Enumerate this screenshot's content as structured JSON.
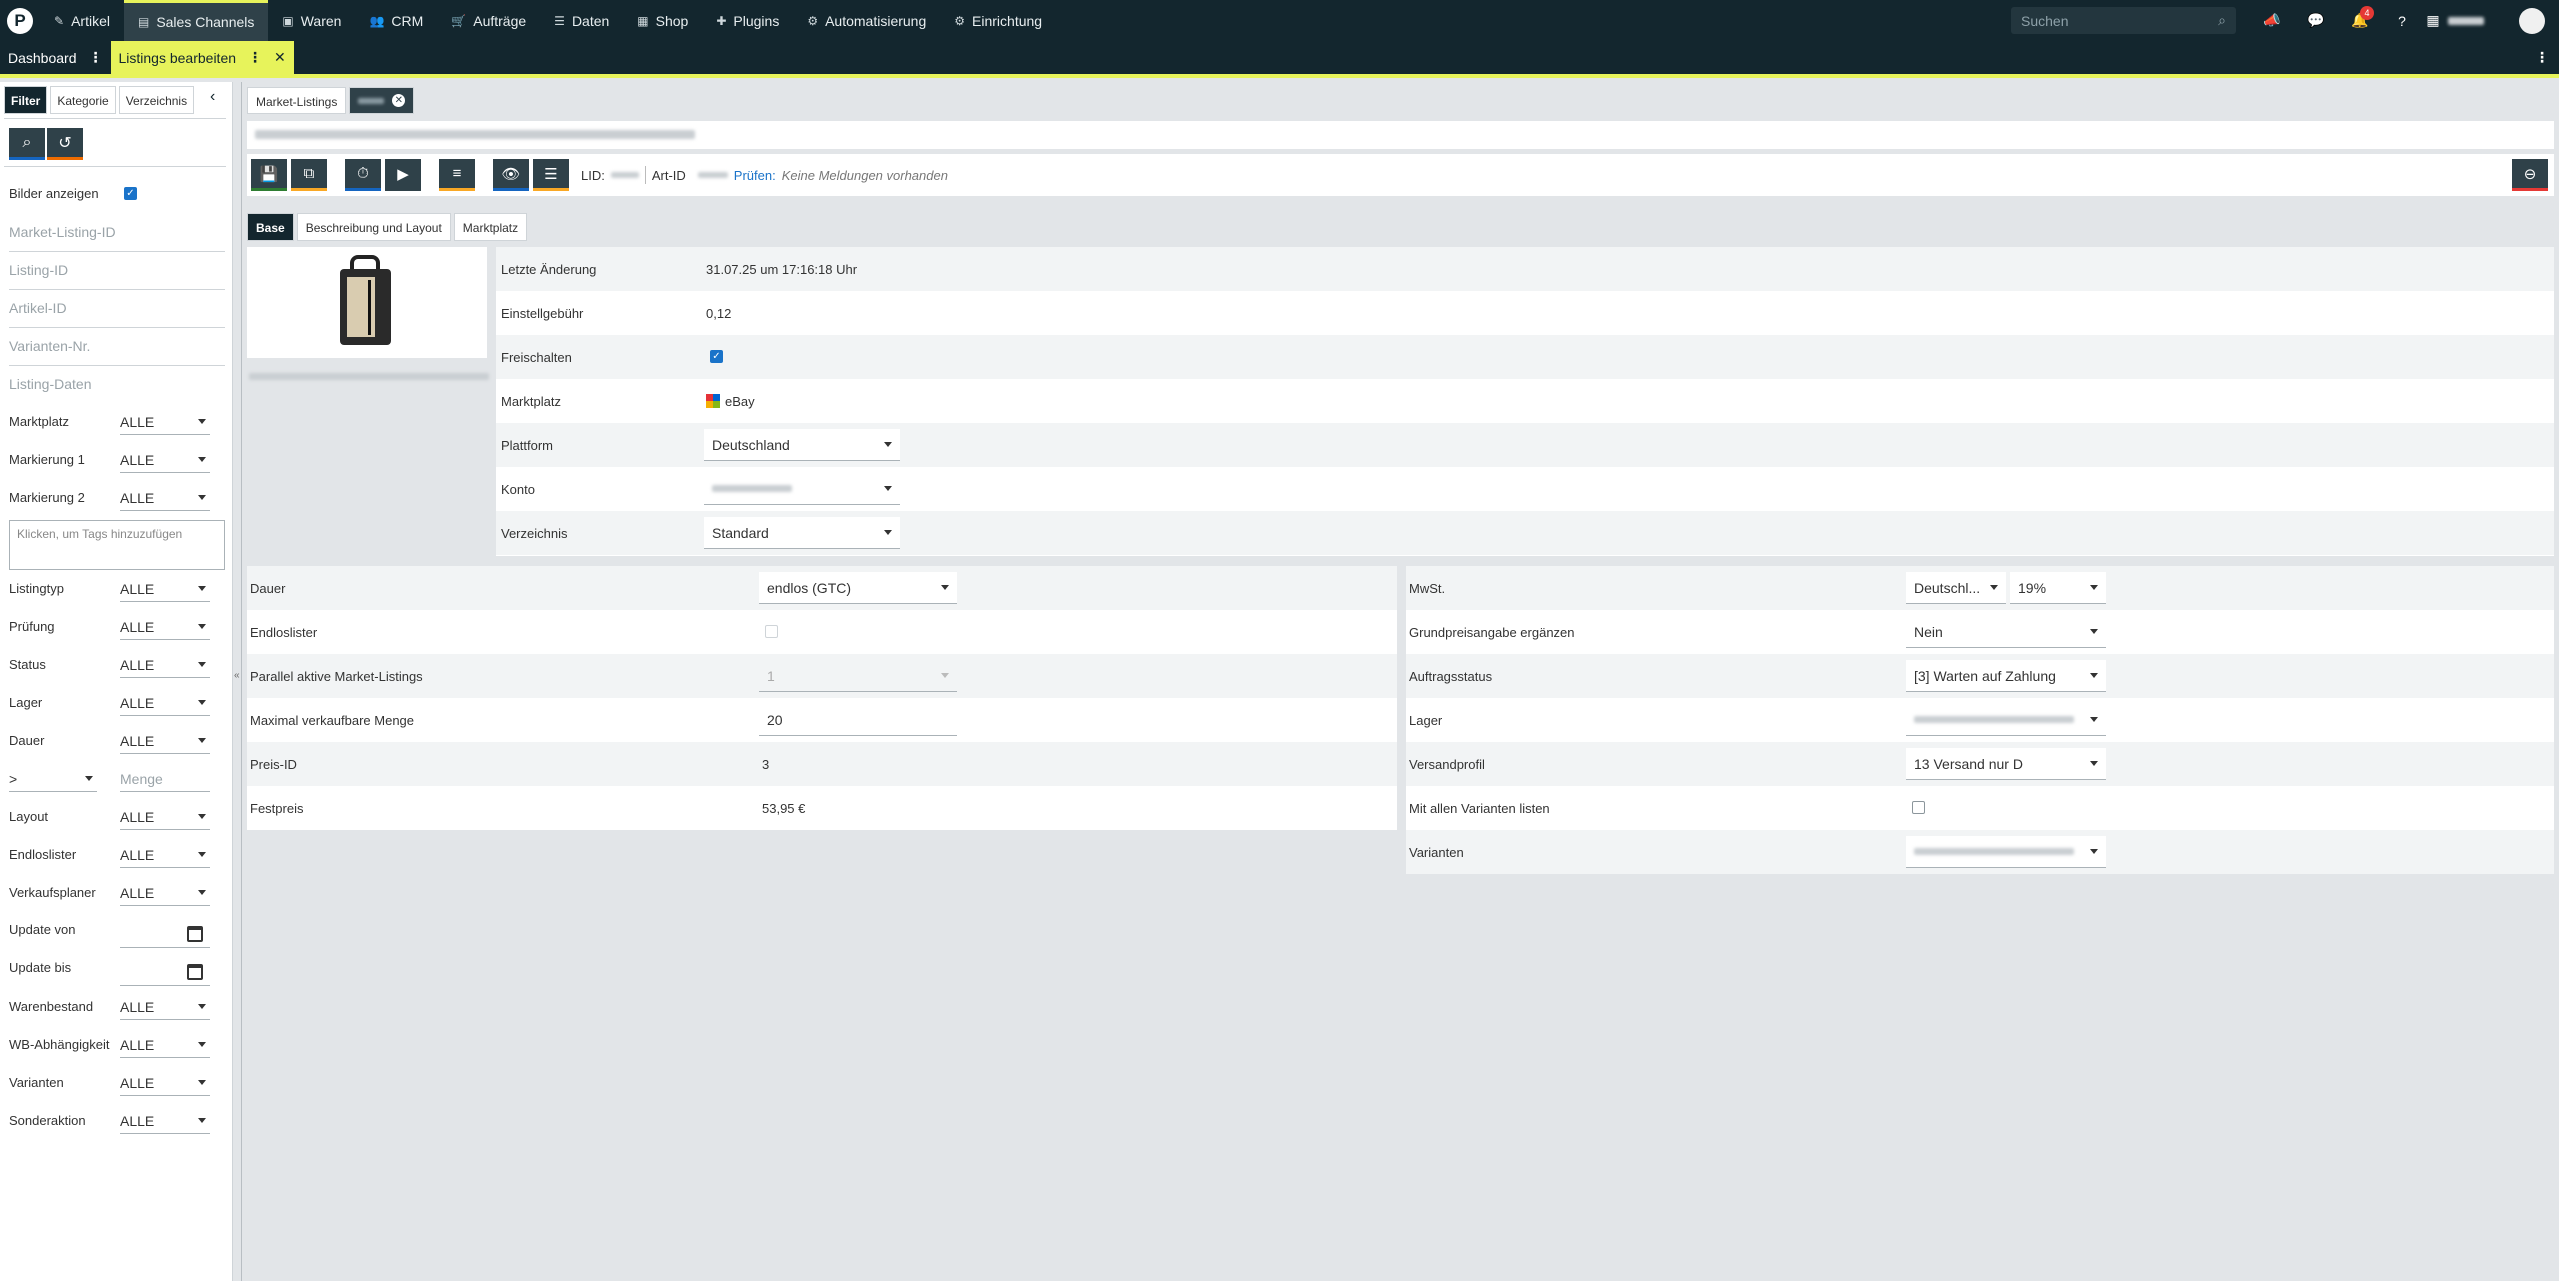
{
  "nav": {
    "items": [
      {
        "icon": "tag-icon",
        "glyph": "✎",
        "label": "Artikel"
      },
      {
        "icon": "store-icon",
        "glyph": "▤",
        "label": "Sales Channels",
        "active": true
      },
      {
        "icon": "box-icon",
        "glyph": "▣",
        "label": "Waren"
      },
      {
        "icon": "users-icon",
        "glyph": "👥",
        "label": "CRM"
      },
      {
        "icon": "cart-icon",
        "glyph": "🛒",
        "label": "Aufträge"
      },
      {
        "icon": "database-icon",
        "glyph": "☰",
        "label": "Daten"
      },
      {
        "icon": "shop-icon",
        "glyph": "▦",
        "label": "Shop"
      },
      {
        "icon": "puzzle-icon",
        "glyph": "✚",
        "label": "Plugins"
      },
      {
        "icon": "automation-icon",
        "glyph": "⚙",
        "label": "Automatisierung"
      },
      {
        "icon": "gear-icon",
        "glyph": "⚙",
        "label": "Einrichtung"
      }
    ],
    "search_placeholder": "Suchen",
    "notification_count": "4"
  },
  "tabs": {
    "dashboard": "Dashboard",
    "current": "Listings bearbeiten"
  },
  "sidebar": {
    "tabs": [
      "Filter",
      "Kategorie",
      "Verzeichnis"
    ],
    "show_images_label": "Bilder anzeigen",
    "placeholders": [
      "Market-Listing-ID",
      "Listing-ID",
      "Artikel-ID",
      "Varianten-Nr.",
      "Listing-Daten"
    ],
    "filters_a": [
      {
        "label": "Marktplatz",
        "value": "ALLE"
      },
      {
        "label": "Markierung 1",
        "value": "ALLE"
      },
      {
        "label": "Markierung 2",
        "value": "ALLE"
      }
    ],
    "tags_placeholder": "Klicken, um Tags hinzuzufügen",
    "filters_b": [
      {
        "label": "Listingtyp",
        "value": "ALLE"
      },
      {
        "label": "Prüfung",
        "value": "ALLE"
      },
      {
        "label": "Status",
        "value": "ALLE"
      },
      {
        "label": "Lager",
        "value": "ALLE"
      },
      {
        "label": "Dauer",
        "value": "ALLE"
      }
    ],
    "compare_op": ">",
    "quantity_placeholder": "Menge",
    "filters_c": [
      {
        "label": "Layout",
        "value": "ALLE"
      },
      {
        "label": "Endloslister",
        "value": "ALLE"
      },
      {
        "label": "Verkaufsplaner",
        "value": "ALLE"
      }
    ],
    "update_from": "Update von",
    "update_to": "Update bis",
    "filters_d": [
      {
        "label": "Warenbestand",
        "value": "ALLE"
      },
      {
        "label": "WB-Abhängigkeit",
        "value": "ALLE"
      },
      {
        "label": "Varianten",
        "value": "ALLE"
      },
      {
        "label": "Sonderaktion",
        "value": "ALLE"
      }
    ]
  },
  "main": {
    "tab_listings": "Market-Listings",
    "toolbar": {
      "lid_label": "LID:",
      "artid_label": "Art-ID",
      "check_label": "Prüfen:",
      "no_messages": "Keine Meldungen vorhanden"
    },
    "subtabs": [
      "Base",
      "Beschreibung und Layout",
      "Marktplatz"
    ],
    "info": {
      "last_change_label": "Letzte Änderung",
      "last_change_value": "31.07.25 um 17:16:18 Uhr",
      "fee_label": "Einstellgebühr",
      "fee_value": "0,12",
      "unlock_label": "Freischalten",
      "marketplace_label": "Marktplatz",
      "marketplace_value": "eBay",
      "platform_label": "Plattform",
      "platform_value": "Deutschland",
      "account_label": "Konto",
      "directory_label": "Verzeichnis",
      "directory_value": "Standard"
    },
    "left": {
      "duration_label": "Dauer",
      "duration_value": "endlos (GTC)",
      "endless_label": "Endloslister",
      "parallel_label": "Parallel aktive Market-Listings",
      "parallel_value": "1",
      "max_qty_label": "Maximal verkaufbare Menge",
      "max_qty_value": "20",
      "price_id_label": "Preis-ID",
      "price_id_value": "3",
      "fixed_price_label": "Festpreis",
      "fixed_price_value": "53,95 €"
    },
    "right": {
      "vat_label": "MwSt.",
      "vat_country": "Deutschl...",
      "vat_rate": "19%",
      "base_price_label": "Grundpreisangabe ergänzen",
      "base_price_value": "Nein",
      "order_status_label": "Auftragsstatus",
      "order_status_value": "[3] Warten auf Zahlung",
      "warehouse_label": "Lager",
      "shipping_label": "Versandprofil",
      "shipping_value": "13 Versand nur D",
      "all_variants_label": "Mit allen Varianten listen",
      "variants_label": "Varianten"
    }
  }
}
